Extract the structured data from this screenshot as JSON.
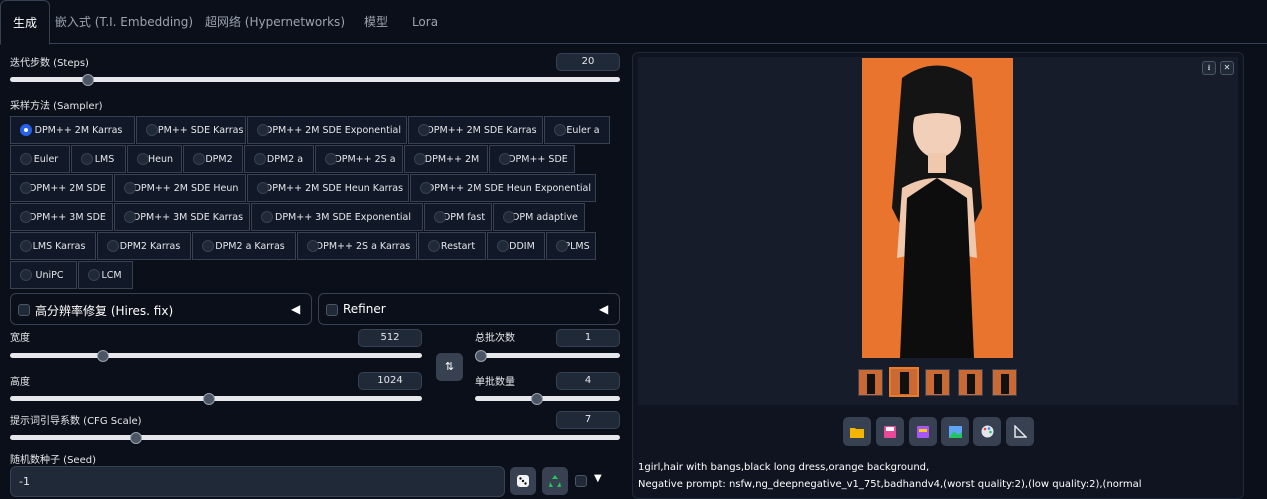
{
  "tabs": [
    {
      "label": "生成",
      "active": true
    },
    {
      "label": "嵌入式 (T.I. Embedding)"
    },
    {
      "label": "超网络 (Hypernetworks)"
    },
    {
      "label": "模型"
    },
    {
      "label": "Lora"
    }
  ],
  "steps": {
    "label": "迭代步数 (Steps)",
    "value": "20",
    "min": 1,
    "max": 150,
    "current": 20
  },
  "sampler": {
    "label": "采样方法 (Sampler)",
    "selected": "DPM++ 2M Karras",
    "rows": [
      [
        "DPM++ 2M Karras",
        "DPM++ SDE Karras",
        "DPM++ 2M SDE Exponential",
        "DPM++ 2M SDE Karras",
        "Euler a"
      ],
      [
        "Euler",
        "LMS",
        "Heun",
        "DPM2",
        "DPM2 a",
        "DPM++ 2S a",
        "DPM++ 2M",
        "DPM++ SDE"
      ],
      [
        "DPM++ 2M SDE",
        "DPM++ 2M SDE Heun",
        "DPM++ 2M SDE Heun Karras",
        "DPM++ 2M SDE Heun Exponential"
      ],
      [
        "DPM++ 3M SDE",
        "DPM++ 3M SDE Karras",
        "DPM++ 3M SDE Exponential",
        "DPM fast",
        "DPM adaptive"
      ],
      [
        "LMS Karras",
        "DPM2 Karras",
        "DPM2 a Karras",
        "DPM++ 2S a Karras",
        "Restart",
        "DDIM",
        "PLMS"
      ],
      [
        "UniPC",
        "LCM"
      ]
    ]
  },
  "hires": {
    "label": "高分辨率修复 (Hires. fix)",
    "arrow": "◀"
  },
  "refiner": {
    "label": "Refiner",
    "arrow": "◀"
  },
  "width": {
    "label": "宽度",
    "value": "512",
    "min": 64,
    "max": 2048,
    "current": 512
  },
  "height": {
    "label": "高度",
    "value": "1024",
    "min": 64,
    "max": 2048,
    "current": 1024
  },
  "batch_count": {
    "label": "总批次数",
    "value": "1",
    "min": 1,
    "max": 100,
    "current": 1
  },
  "batch_size": {
    "label": "单批数量",
    "value": "4",
    "min": 1,
    "max": 8,
    "current": 4
  },
  "swap_icon": "⇅",
  "cfg": {
    "label": "提示词引导系数 (CFG Scale)",
    "value": "7",
    "min": 1,
    "max": 30,
    "current": 7
  },
  "seed": {
    "label": "随机数种子 (Seed)",
    "value": "-1",
    "extra_arrow": "▼"
  },
  "icons": {
    "dice": "dice-icon",
    "recycle": "recycle-icon",
    "download": "download-icon",
    "close": "close-icon",
    "folder": "folder-icon",
    "save": "save-icon",
    "zip": "zip-icon",
    "img2img": "image-icon",
    "inpaint": "palette-icon",
    "extras": "ruler-icon"
  },
  "colors": {
    "accent": "#2563eb",
    "orange": "#ea7c28",
    "bg": "#0b0f19"
  },
  "output": {
    "prompt": "1girl,hair with bangs,black long dress,orange background,",
    "negative": "Negative prompt: nsfw,ng_deepnegative_v1_75t,badhandv4,(worst quality:2),(low quality:2),(normal"
  }
}
